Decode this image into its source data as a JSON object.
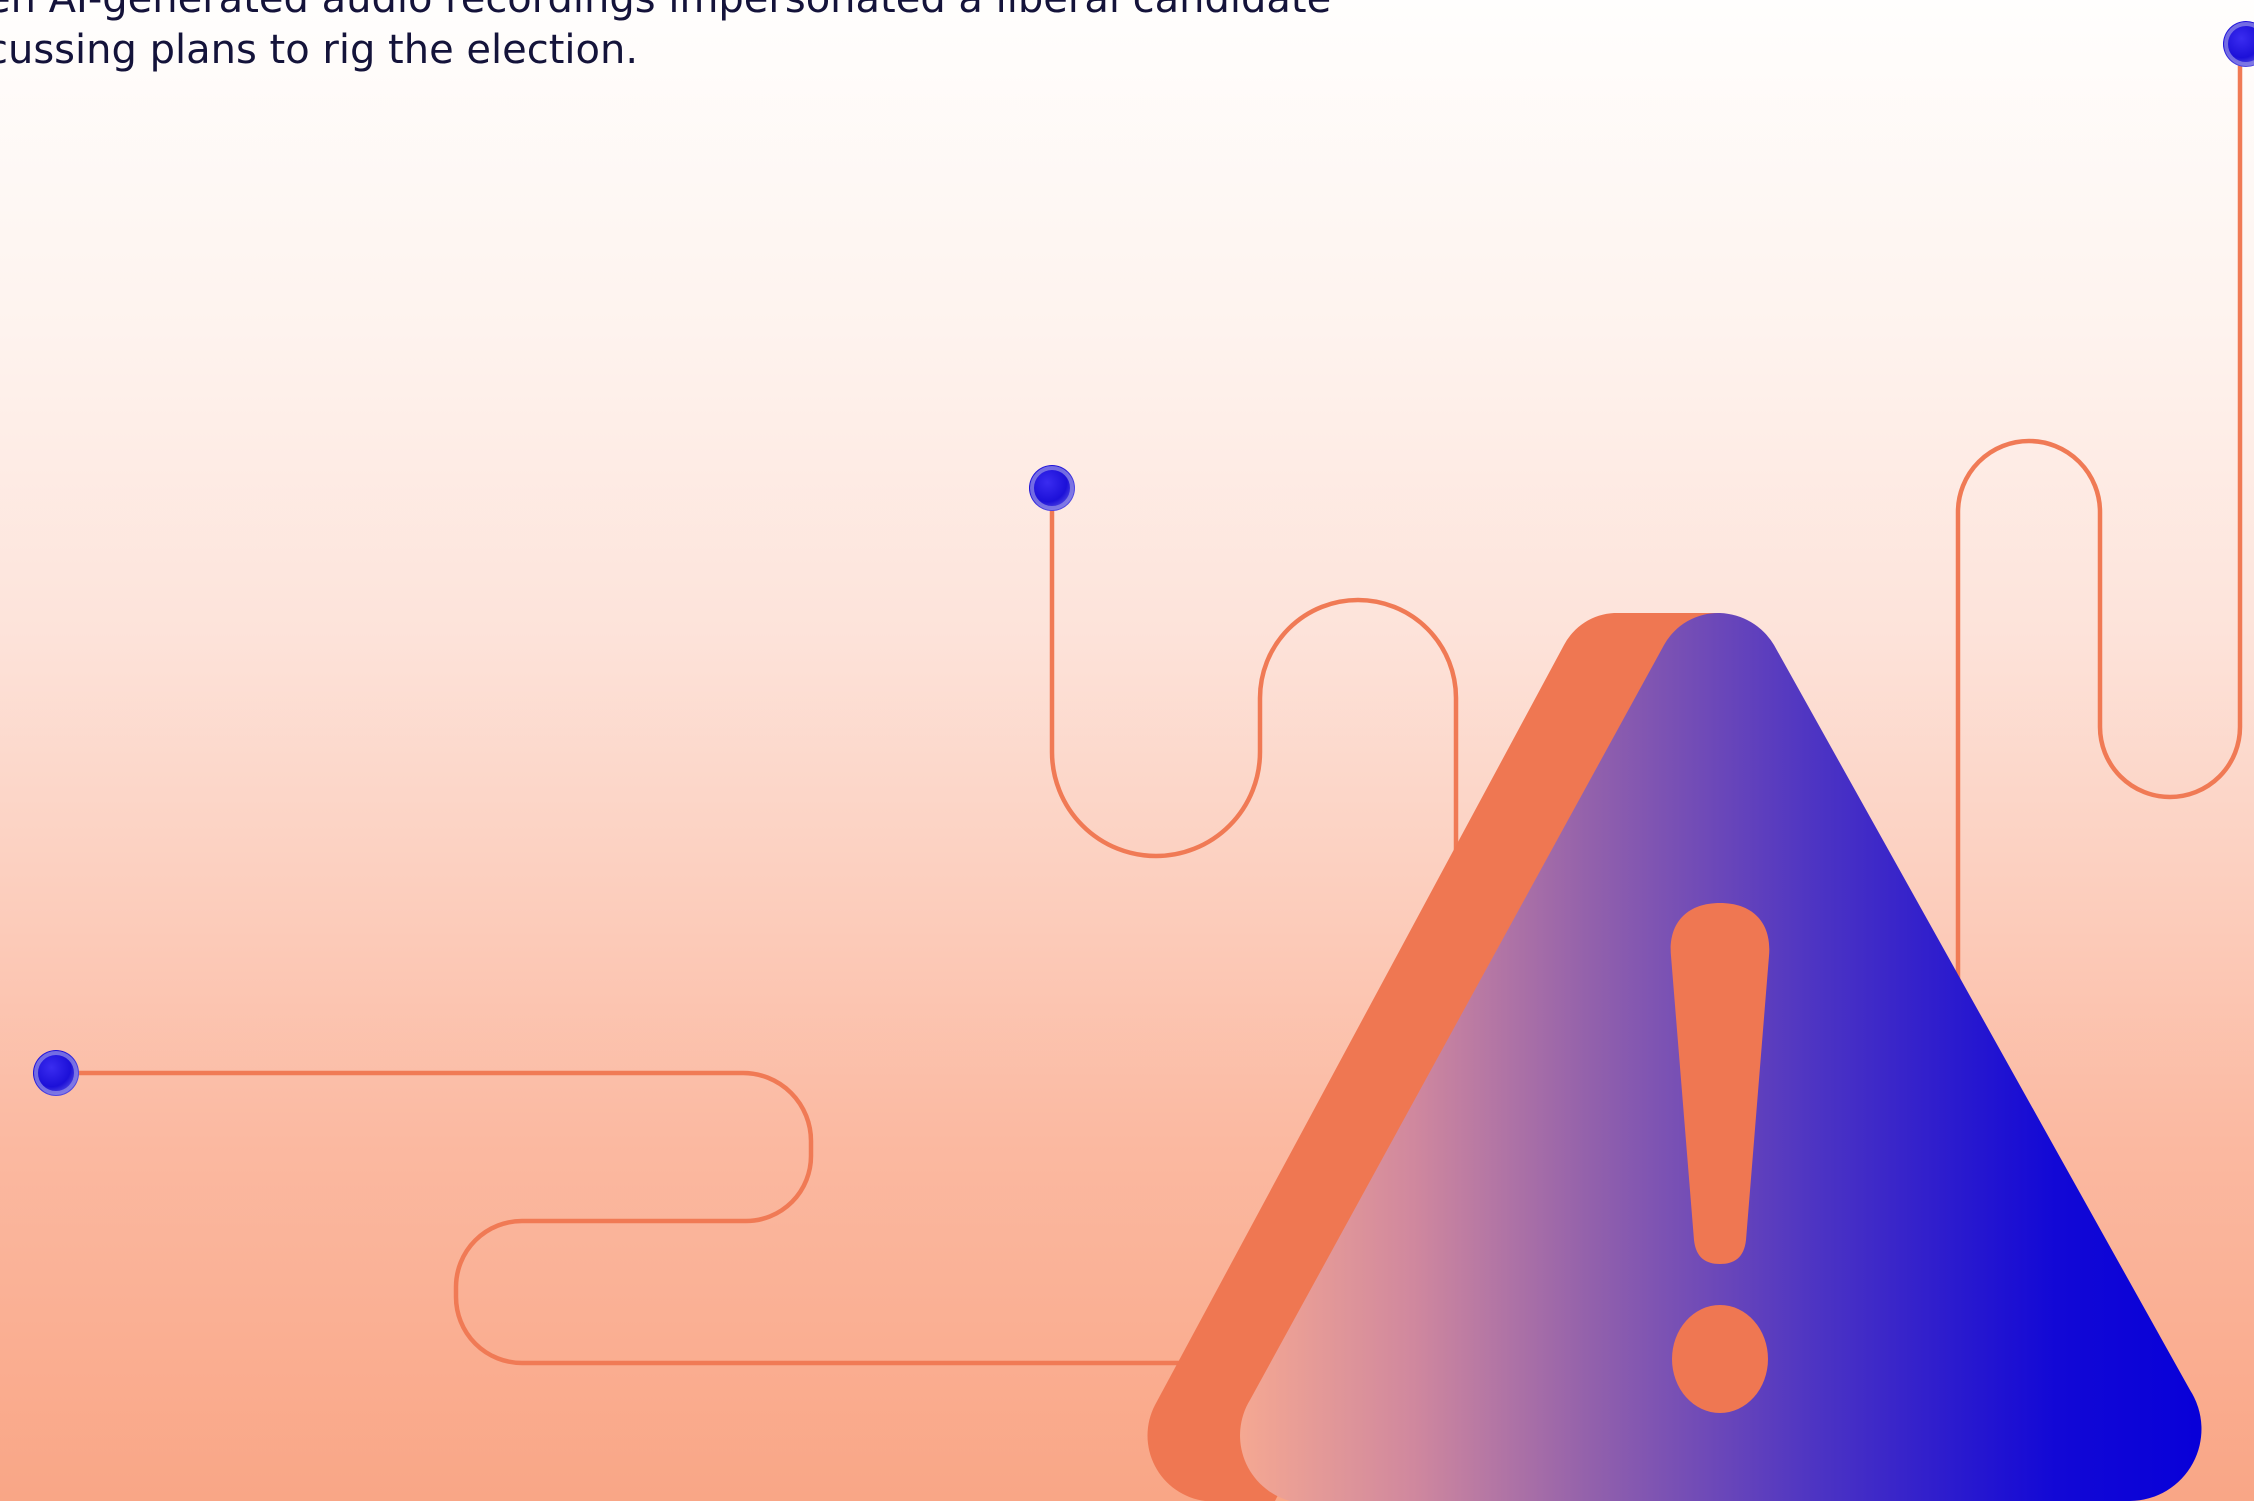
{
  "text_block": {
    "line1": "en AI-generated audio recordings impersonated a liberal candidate",
    "line2": "cussing plans to rig the election."
  },
  "colors": {
    "accent_orange": "#f07a55",
    "triangle_orange": "#ef7752",
    "deep_blue": "#0800d8",
    "mid_purple": "#8c62ad",
    "dark_text": "#14133a"
  },
  "icons": [
    "warning-triangle-icon",
    "exclamation-mark-icon",
    "connector-pin-icon"
  ]
}
